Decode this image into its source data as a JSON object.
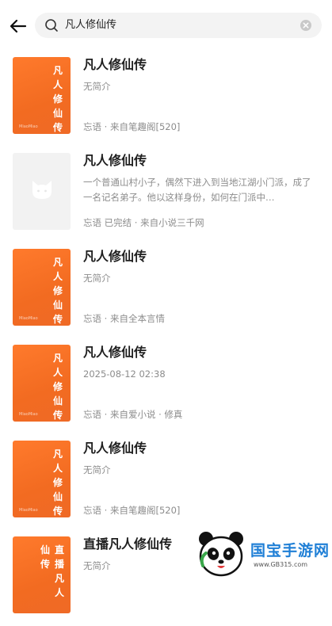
{
  "search": {
    "query": "凡人修仙传"
  },
  "results": [
    {
      "title": "凡人修仙传",
      "desc": "无简介",
      "meta": "忘语 · 来自笔趣阁[520]",
      "cover_text": "凡人修仙传",
      "cover": "orange"
    },
    {
      "title": "凡人修仙传",
      "desc": "一个普通山村小子，偶然下进入到当地江湖小门派，成了一名记名弟子。他以这样身份，如何在门派中…",
      "meta": "忘语  已完结 · 来自小说三千网",
      "cover_text": "",
      "cover": "gray"
    },
    {
      "title": "凡人修仙传",
      "desc": "无简介",
      "meta": "忘语 · 来自全本言情",
      "cover_text": "凡人修仙传",
      "cover": "orange"
    },
    {
      "title": "凡人修仙传",
      "desc": "2025-08-12 02:38",
      "meta": "忘语 · 来自爱小说 · 修真",
      "cover_text": "凡人修仙传",
      "cover": "orange"
    },
    {
      "title": "凡人修仙传",
      "desc": "无简介",
      "meta": "忘语 · 来自笔趣阁[520]",
      "cover_text": "凡人修仙传",
      "cover": "orange"
    },
    {
      "title": "直播凡人修仙传",
      "desc": "无简介",
      "meta": "",
      "cover_text_col1": "直播凡人",
      "cover_text_col2": "仙传",
      "cover": "orange"
    }
  ],
  "cover_brand": "MiaoMiao",
  "watermark": {
    "name": "国宝手游网",
    "url": "www.GB315.com"
  },
  "colors": {
    "accent": "#f26b21",
    "text_muted": "#8c8c8c"
  }
}
